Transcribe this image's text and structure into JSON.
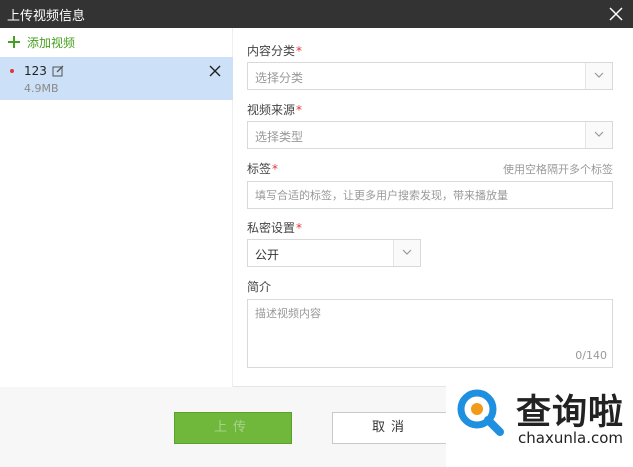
{
  "dialog": {
    "title": "上传视频信息"
  },
  "sidebar": {
    "add_label": "添加视频",
    "files": [
      {
        "name": "123",
        "size": "4.9MB"
      }
    ]
  },
  "form": {
    "category": {
      "label": "内容分类",
      "required_mark": "*",
      "placeholder": "选择分类"
    },
    "source": {
      "label": "视频来源",
      "required_mark": "*",
      "placeholder": "选择类型"
    },
    "tags": {
      "label": "标签",
      "required_mark": "*",
      "hint": "使用空格隔开多个标签",
      "placeholder": "填写合适的标签，让更多用户搜索发现，带来播放量"
    },
    "privacy": {
      "label": "私密设置",
      "required_mark": "*",
      "value": "公开"
    },
    "intro": {
      "label": "简介",
      "placeholder": "描述视频内容",
      "counter": "0/140"
    }
  },
  "footer": {
    "upload_label": "上传",
    "cancel_label": "取消"
  },
  "watermark": {
    "brand": "查询啦",
    "domain": "chaxunla.com"
  },
  "colors": {
    "titlebar": "#333333",
    "accent_green": "#46a020",
    "upload_button": "#6fb83c",
    "selected_row": "#cce0f7",
    "required": "#e0363b",
    "logo_blue": "#1f8fe0",
    "logo_orange": "#f39a1b"
  }
}
